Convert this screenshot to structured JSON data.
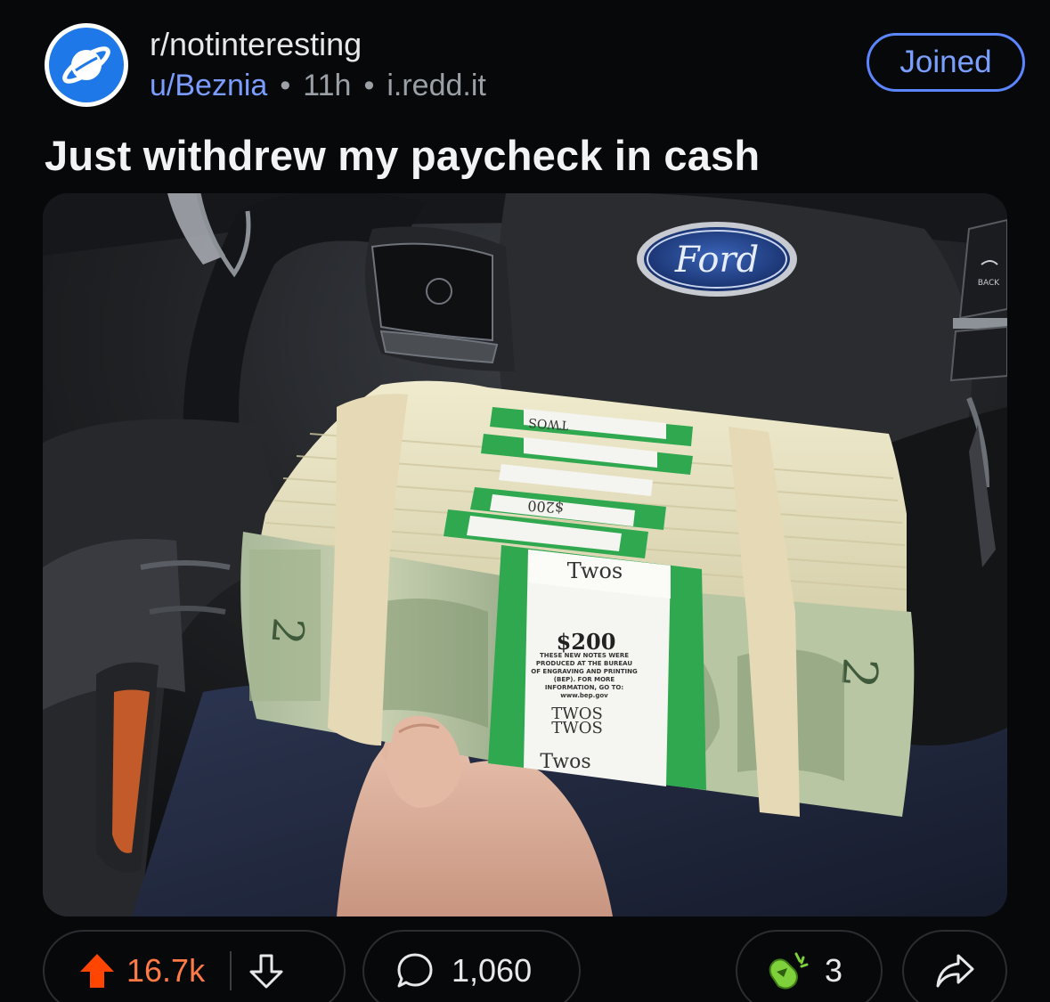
{
  "post": {
    "subreddit": "r/notinteresting",
    "author": "u/Beznia",
    "age": "11h",
    "domain": "i.redd.it",
    "separator": "•",
    "join_label": "Joined",
    "title": "Just withdrew my paycheck in cash"
  },
  "image": {
    "steering_logo": "Ford",
    "back_label": "BACK",
    "band_top_label": "TWOS",
    "band_top_amount": "$200",
    "band_main_label": "Twos",
    "band_amount": "$200",
    "band_notice": "THESE NEW NOTES WERE PRODUCED AT THE BUREAU OF ENGRAVING AND PRINTING (BEP). FOR MORE INFORMATION, GO TO: www.bep.gov",
    "band_twos_1": "TWOS",
    "band_twos_2": "TWOS",
    "band_bottom_label": "Twos"
  },
  "actions": {
    "upvote_count": "16.7k",
    "comment_count": "1,060",
    "award_count": "3"
  },
  "colors": {
    "accent_blue": "#5b86ff",
    "upvote_orange": "#ff4500",
    "subreddit_icon": "#1f78e8",
    "band_green": "#2fa84f"
  },
  "icons": {
    "subreddit_avatar": "planet-icon",
    "upvote": "upvote-arrow-icon",
    "downvote": "downvote-arrow-icon",
    "comment": "comment-bubble-icon",
    "award": "award-icon",
    "share": "share-arrow-icon"
  }
}
